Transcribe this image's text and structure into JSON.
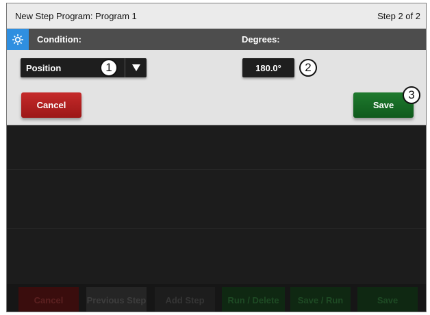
{
  "titlebar": {
    "title": "New Step Program:  Program 1",
    "step": "Step 2 of 2"
  },
  "header": {
    "icon": "gear-icon",
    "condition_label": "Condition:",
    "degrees_label": "Degrees:"
  },
  "form": {
    "condition_value": "Position",
    "degrees_value": "180.0°",
    "cancel_label": "Cancel",
    "save_label": "Save"
  },
  "callouts": [
    "1",
    "2",
    "3"
  ],
  "footer": {
    "cancel": "Cancel",
    "previous_step": "Previous Step",
    "add_step": "Add Step",
    "run_delete": "Run / Delete",
    "save_run": "Save / Run",
    "save": "Save"
  },
  "colors": {
    "accent_blue": "#2f8fe0",
    "cancel_red": "#b32020",
    "save_green": "#17682a",
    "header_gray": "#4d4d4d"
  }
}
